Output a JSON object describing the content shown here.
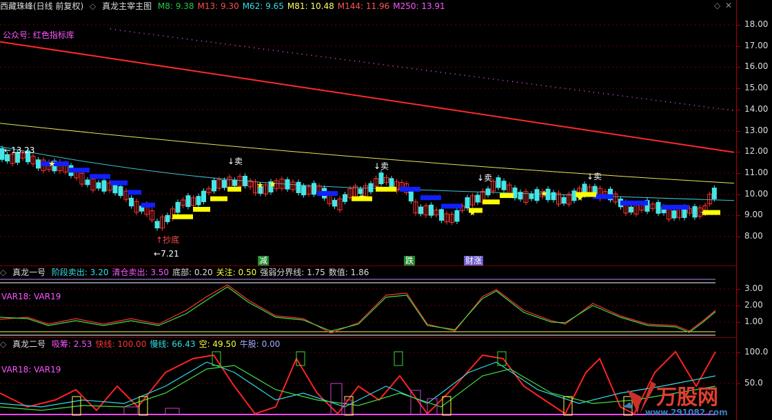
{
  "main": {
    "stock": "西藏珠峰(日线 前复权)",
    "indicator": "真龙主宰主图",
    "ma": [
      {
        "label": "M8: 9.38",
        "color": "#22c84a"
      },
      {
        "label": "M13: 9.30",
        "color": "#ff4d4d"
      },
      {
        "label": "M62: 9.65",
        "color": "#33dde5"
      },
      {
        "label": "M81: 10.48",
        "color": "#ffff66"
      },
      {
        "label": "M144: 11.96",
        "color": "#ff5555"
      },
      {
        "label": "M250: 13.91",
        "color": "#ff55ff"
      }
    ],
    "gzh": "公众号: 红色指标库",
    "high_label": "13.23",
    "low_label": "7.21",
    "bottom_label": "抄底",
    "sell_label": "↓卖",
    "tags": [
      {
        "text": "减",
        "color": "#1c8a2a"
      },
      {
        "text": "跌",
        "color": "#1c8a2a"
      },
      {
        "text": "财涨",
        "color": "#6a5acd"
      }
    ],
    "yticks": [
      "18.00",
      "17.00",
      "16.00",
      "15.00",
      "14.00",
      "13.00",
      "12.00",
      "11.00",
      "10.00",
      "9.00",
      "8.00"
    ],
    "colors": {
      "candle_up": "#ff3333",
      "candle_down": "#44e6e6",
      "m144": "#ff2a2a",
      "m81": "#e8e85c",
      "m62": "#38c8d8"
    }
  },
  "panel1": {
    "name": "真龙一号",
    "items": [
      {
        "label": "阶段卖出: 3.20",
        "color": "#33dde5"
      },
      {
        "label": "清仓卖出: 3.50",
        "color": "#ff55ff"
      },
      {
        "label": "底部: 0.20",
        "color": "#dddddd"
      },
      {
        "label": "关注: 0.50",
        "color": "#ffff44"
      },
      {
        "label": "强弱分界线: 1.75",
        "color": "#dddddd"
      },
      {
        "label": "数值: 1.86",
        "color": "#dddddd"
      }
    ],
    "var_label": "VAR18: VAR19",
    "yticks": [
      "3.00",
      "2.00",
      "1.00"
    ]
  },
  "panel2": {
    "name": "真龙二号",
    "items": [
      {
        "label": "吸筹: 2.53",
        "color": "#ff55ff"
      },
      {
        "label": "快线: 100.00",
        "color": "#ff3333"
      },
      {
        "label": "慢线: 66.43",
        "color": "#33dde5"
      },
      {
        "label": "空: 49.50",
        "color": "#ffff44"
      },
      {
        "label": "牛股: 0.00",
        "color": "#aaaaff"
      }
    ],
    "var_label": "VAR18: VAR19",
    "yticks": [
      "100.0",
      "50.0"
    ]
  },
  "watermark": {
    "brand": "万股网",
    "url": "www.291082.com"
  }
}
